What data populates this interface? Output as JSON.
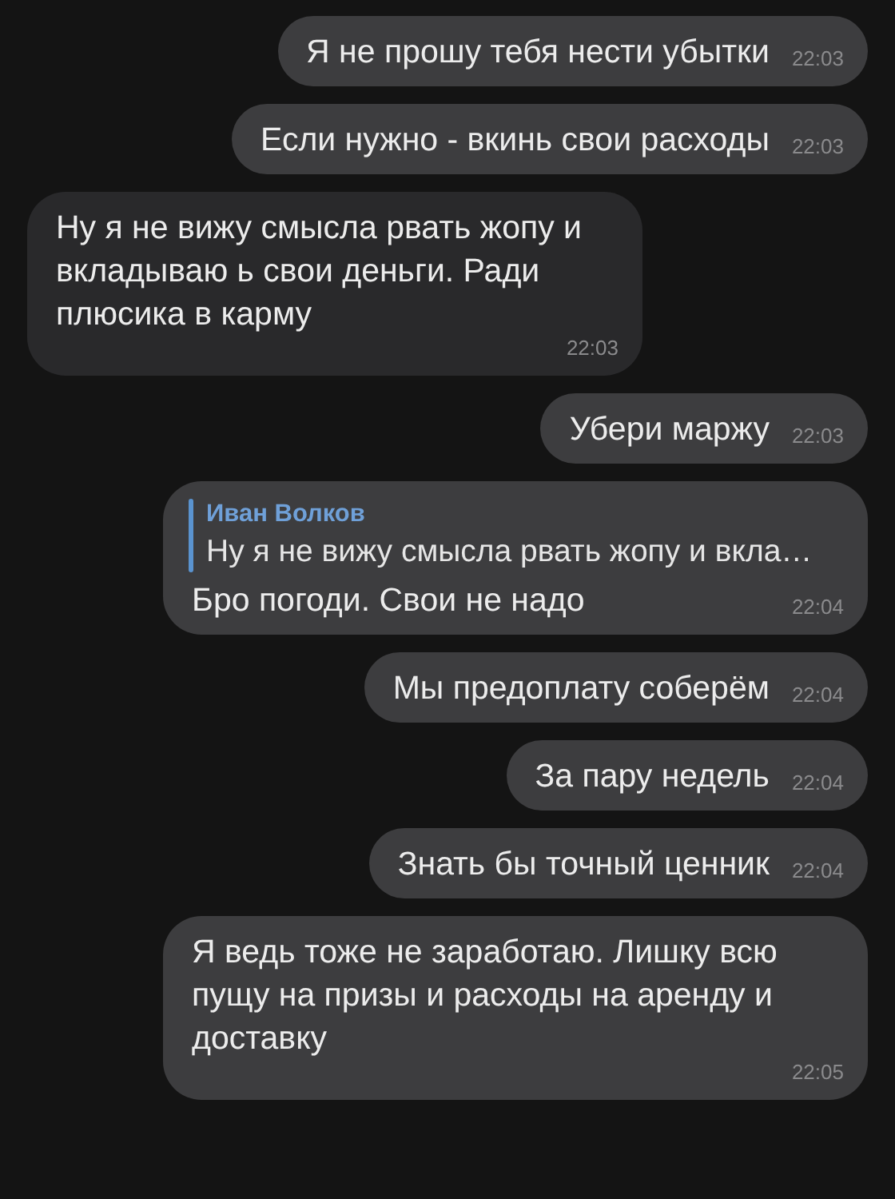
{
  "messages": [
    {
      "kind": "outgoing",
      "text": "Я не прошу тебя нести убытки",
      "time": "22:03"
    },
    {
      "kind": "outgoing",
      "text": "Если нужно - вкинь свои расходы",
      "time": "22:03"
    },
    {
      "kind": "incoming",
      "text": "Ну я не вижу смысла рвать жопу и вкладываю ь свои деньги. Ради плюсика в карму",
      "time": "22:03"
    },
    {
      "kind": "outgoing",
      "text": "Убери маржу",
      "time": "22:03"
    },
    {
      "kind": "outgoing",
      "reply": {
        "author": "Иван Волков",
        "text": "Ну я не вижу смысла рвать жопу и вкла…"
      },
      "text": "Бро погоди. Свои не надо",
      "time": "22:04"
    },
    {
      "kind": "outgoing",
      "text": "Мы предоплату соберём",
      "time": "22:04"
    },
    {
      "kind": "outgoing",
      "text": "За пару недель",
      "time": "22:04"
    },
    {
      "kind": "outgoing",
      "text": "Знать бы точный ценник",
      "time": "22:04"
    },
    {
      "kind": "outgoing",
      "text": "Я ведь тоже не заработаю. Лишку всю пущу на призы и расходы на аренду и доставку",
      "time": "22:05"
    }
  ]
}
